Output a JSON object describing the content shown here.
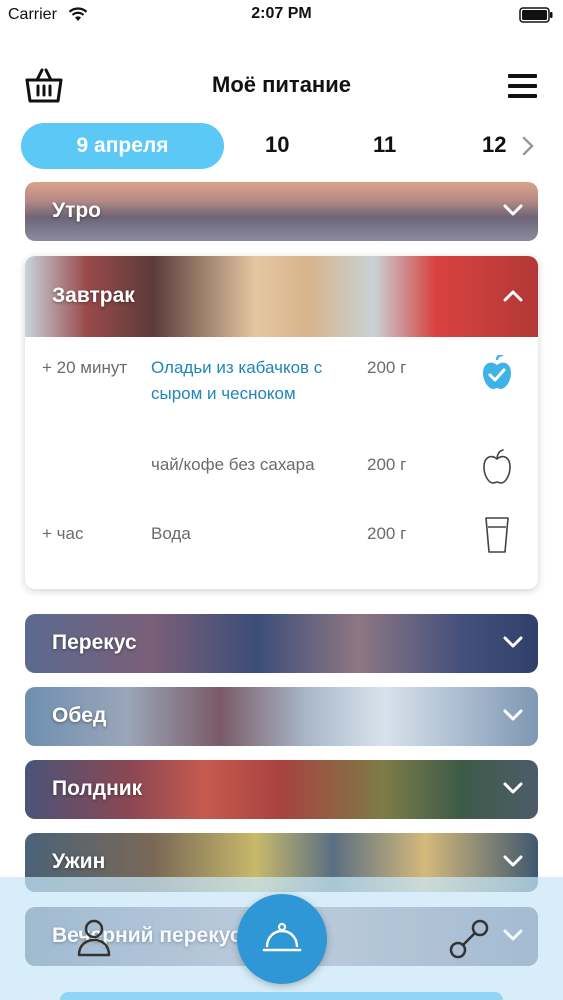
{
  "status_bar": {
    "carrier": "Carrier",
    "time": "2:07 PM"
  },
  "header": {
    "title": "Моё питание",
    "left_icon": "basket-icon",
    "right_icon": "menu-icon"
  },
  "dates": {
    "active": "9 апреля",
    "items": [
      "10",
      "11",
      "12"
    ]
  },
  "meals": [
    {
      "label": "Утро",
      "expanded": false
    },
    {
      "label": "Завтрак",
      "expanded": true,
      "items": [
        {
          "time": "+ 20 минут",
          "name": "Оладьи из кабачков с сыром и чесноком",
          "qty": "200 г",
          "icon": "apple-check-icon",
          "done": true
        },
        {
          "time": "",
          "name": "чай/кофе без сахара",
          "qty": "200 г",
          "icon": "apple-icon",
          "done": false
        },
        {
          "time": "+ час",
          "name": "Вода",
          "qty": "200 г",
          "icon": "glass-icon",
          "done": false
        }
      ]
    },
    {
      "label": "Перекус",
      "expanded": false
    },
    {
      "label": "Обед",
      "expanded": false
    },
    {
      "label": "Полдник",
      "expanded": false
    },
    {
      "label": "Ужин",
      "expanded": false
    },
    {
      "label": "Вечерний перекус",
      "expanded": false
    }
  ],
  "bottom_nav": {
    "left_icon": "profile-icon",
    "center_icon": "cloche-icon",
    "right_icon": "dumbbell-icon"
  },
  "colors": {
    "accent": "#5bc8f5",
    "link": "#1f86b8",
    "center_button": "#2f97d6",
    "check_icon": "#3fb2ea"
  }
}
